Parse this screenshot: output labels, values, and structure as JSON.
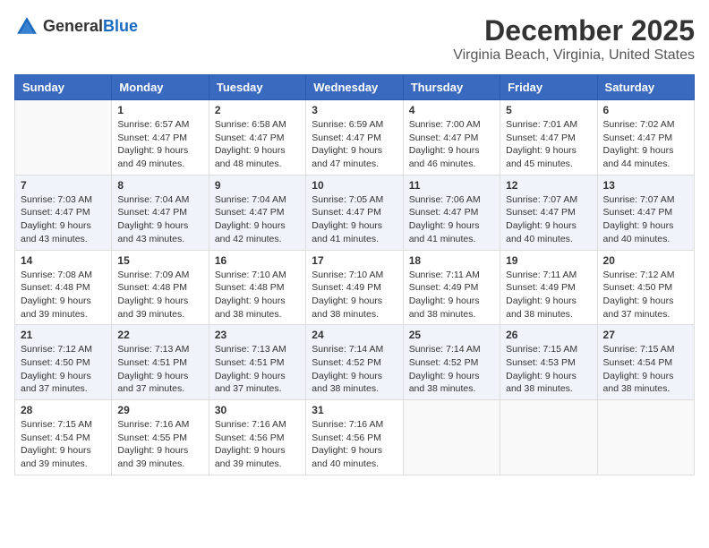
{
  "logo": {
    "general": "General",
    "blue": "Blue"
  },
  "title": "December 2025",
  "location": "Virginia Beach, Virginia, United States",
  "weekdays": [
    "Sunday",
    "Monday",
    "Tuesday",
    "Wednesday",
    "Thursday",
    "Friday",
    "Saturday"
  ],
  "weeks": [
    [
      {
        "day": "",
        "sunrise": "",
        "sunset": "",
        "daylight": ""
      },
      {
        "day": "1",
        "sunrise": "Sunrise: 6:57 AM",
        "sunset": "Sunset: 4:47 PM",
        "daylight": "Daylight: 9 hours and 49 minutes."
      },
      {
        "day": "2",
        "sunrise": "Sunrise: 6:58 AM",
        "sunset": "Sunset: 4:47 PM",
        "daylight": "Daylight: 9 hours and 48 minutes."
      },
      {
        "day": "3",
        "sunrise": "Sunrise: 6:59 AM",
        "sunset": "Sunset: 4:47 PM",
        "daylight": "Daylight: 9 hours and 47 minutes."
      },
      {
        "day": "4",
        "sunrise": "Sunrise: 7:00 AM",
        "sunset": "Sunset: 4:47 PM",
        "daylight": "Daylight: 9 hours and 46 minutes."
      },
      {
        "day": "5",
        "sunrise": "Sunrise: 7:01 AM",
        "sunset": "Sunset: 4:47 PM",
        "daylight": "Daylight: 9 hours and 45 minutes."
      },
      {
        "day": "6",
        "sunrise": "Sunrise: 7:02 AM",
        "sunset": "Sunset: 4:47 PM",
        "daylight": "Daylight: 9 hours and 44 minutes."
      }
    ],
    [
      {
        "day": "7",
        "sunrise": "Sunrise: 7:03 AM",
        "sunset": "Sunset: 4:47 PM",
        "daylight": "Daylight: 9 hours and 43 minutes."
      },
      {
        "day": "8",
        "sunrise": "Sunrise: 7:04 AM",
        "sunset": "Sunset: 4:47 PM",
        "daylight": "Daylight: 9 hours and 43 minutes."
      },
      {
        "day": "9",
        "sunrise": "Sunrise: 7:04 AM",
        "sunset": "Sunset: 4:47 PM",
        "daylight": "Daylight: 9 hours and 42 minutes."
      },
      {
        "day": "10",
        "sunrise": "Sunrise: 7:05 AM",
        "sunset": "Sunset: 4:47 PM",
        "daylight": "Daylight: 9 hours and 41 minutes."
      },
      {
        "day": "11",
        "sunrise": "Sunrise: 7:06 AM",
        "sunset": "Sunset: 4:47 PM",
        "daylight": "Daylight: 9 hours and 41 minutes."
      },
      {
        "day": "12",
        "sunrise": "Sunrise: 7:07 AM",
        "sunset": "Sunset: 4:47 PM",
        "daylight": "Daylight: 9 hours and 40 minutes."
      },
      {
        "day": "13",
        "sunrise": "Sunrise: 7:07 AM",
        "sunset": "Sunset: 4:47 PM",
        "daylight": "Daylight: 9 hours and 40 minutes."
      }
    ],
    [
      {
        "day": "14",
        "sunrise": "Sunrise: 7:08 AM",
        "sunset": "Sunset: 4:48 PM",
        "daylight": "Daylight: 9 hours and 39 minutes."
      },
      {
        "day": "15",
        "sunrise": "Sunrise: 7:09 AM",
        "sunset": "Sunset: 4:48 PM",
        "daylight": "Daylight: 9 hours and 39 minutes."
      },
      {
        "day": "16",
        "sunrise": "Sunrise: 7:10 AM",
        "sunset": "Sunset: 4:48 PM",
        "daylight": "Daylight: 9 hours and 38 minutes."
      },
      {
        "day": "17",
        "sunrise": "Sunrise: 7:10 AM",
        "sunset": "Sunset: 4:49 PM",
        "daylight": "Daylight: 9 hours and 38 minutes."
      },
      {
        "day": "18",
        "sunrise": "Sunrise: 7:11 AM",
        "sunset": "Sunset: 4:49 PM",
        "daylight": "Daylight: 9 hours and 38 minutes."
      },
      {
        "day": "19",
        "sunrise": "Sunrise: 7:11 AM",
        "sunset": "Sunset: 4:49 PM",
        "daylight": "Daylight: 9 hours and 38 minutes."
      },
      {
        "day": "20",
        "sunrise": "Sunrise: 7:12 AM",
        "sunset": "Sunset: 4:50 PM",
        "daylight": "Daylight: 9 hours and 37 minutes."
      }
    ],
    [
      {
        "day": "21",
        "sunrise": "Sunrise: 7:12 AM",
        "sunset": "Sunset: 4:50 PM",
        "daylight": "Daylight: 9 hours and 37 minutes."
      },
      {
        "day": "22",
        "sunrise": "Sunrise: 7:13 AM",
        "sunset": "Sunset: 4:51 PM",
        "daylight": "Daylight: 9 hours and 37 minutes."
      },
      {
        "day": "23",
        "sunrise": "Sunrise: 7:13 AM",
        "sunset": "Sunset: 4:51 PM",
        "daylight": "Daylight: 9 hours and 37 minutes."
      },
      {
        "day": "24",
        "sunrise": "Sunrise: 7:14 AM",
        "sunset": "Sunset: 4:52 PM",
        "daylight": "Daylight: 9 hours and 38 minutes."
      },
      {
        "day": "25",
        "sunrise": "Sunrise: 7:14 AM",
        "sunset": "Sunset: 4:52 PM",
        "daylight": "Daylight: 9 hours and 38 minutes."
      },
      {
        "day": "26",
        "sunrise": "Sunrise: 7:15 AM",
        "sunset": "Sunset: 4:53 PM",
        "daylight": "Daylight: 9 hours and 38 minutes."
      },
      {
        "day": "27",
        "sunrise": "Sunrise: 7:15 AM",
        "sunset": "Sunset: 4:54 PM",
        "daylight": "Daylight: 9 hours and 38 minutes."
      }
    ],
    [
      {
        "day": "28",
        "sunrise": "Sunrise: 7:15 AM",
        "sunset": "Sunset: 4:54 PM",
        "daylight": "Daylight: 9 hours and 39 minutes."
      },
      {
        "day": "29",
        "sunrise": "Sunrise: 7:16 AM",
        "sunset": "Sunset: 4:55 PM",
        "daylight": "Daylight: 9 hours and 39 minutes."
      },
      {
        "day": "30",
        "sunrise": "Sunrise: 7:16 AM",
        "sunset": "Sunset: 4:56 PM",
        "daylight": "Daylight: 9 hours and 39 minutes."
      },
      {
        "day": "31",
        "sunrise": "Sunrise: 7:16 AM",
        "sunset": "Sunset: 4:56 PM",
        "daylight": "Daylight: 9 hours and 40 minutes."
      },
      {
        "day": "",
        "sunrise": "",
        "sunset": "",
        "daylight": ""
      },
      {
        "day": "",
        "sunrise": "",
        "sunset": "",
        "daylight": ""
      },
      {
        "day": "",
        "sunrise": "",
        "sunset": "",
        "daylight": ""
      }
    ]
  ]
}
